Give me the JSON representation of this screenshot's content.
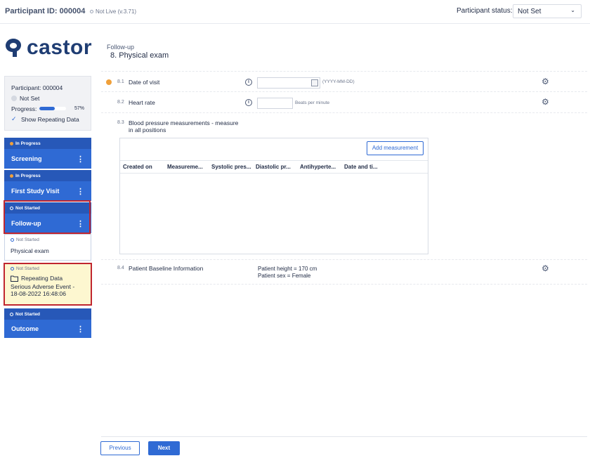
{
  "header": {
    "participant_id": "Participant ID: 000004",
    "env_label": "Not Live (v.3.71)",
    "participant_status_label": "Participant status:",
    "participant_status_value": "Not Set"
  },
  "brand": {
    "logo_text": "castor",
    "color": "#1f3d73"
  },
  "page": {
    "breadcrumb": "Follow-up",
    "title": "8. Physical exam"
  },
  "participant_card": {
    "participant": "Participant: 000004",
    "status": "Not Set",
    "progress_label": "Progress:",
    "progress_value": 0.57,
    "progress_pct": "57%",
    "show_repeating": "Show Repeating Data"
  },
  "sidebar": {
    "phases": [
      {
        "status": "In Progress",
        "name": "Screening"
      },
      {
        "status": "In Progress",
        "name": "First Study Visit"
      },
      {
        "status": "Not Started",
        "name": "Follow-up"
      },
      {
        "status": "Not Started",
        "name": "Outcome"
      }
    ],
    "step": {
      "status": "Not Started",
      "name": "Physical exam"
    },
    "repeating": {
      "status": "Not Started",
      "title": "Repeating Data",
      "line1": "Serious Adverse Event -",
      "line2": "18-08-2022 16:48:06"
    }
  },
  "form": {
    "q1": {
      "num": "8.1",
      "label": "Date of visit",
      "hint": "(YYYY-MM-DD)"
    },
    "q2": {
      "num": "8.2",
      "label": "Heart rate",
      "hint": "Beats per minute"
    },
    "q3": {
      "num": "8.3",
      "label_line1": "Blood pressure measurements - measure",
      "label_line2": "in all positions"
    },
    "q4": {
      "num": "8.4",
      "label": "Patient Baseline Information",
      "line1": "Patient height = 170 cm",
      "line2": "Patient sex = Female"
    },
    "grid": {
      "add_button": "Add measurement",
      "columns": [
        "Created on",
        "Measureme...",
        "Systolic pres...",
        "Diastolic pr...",
        "Antihyperte...",
        "Date and ti..."
      ]
    }
  },
  "footer": {
    "previous": "Previous",
    "next": "Next"
  },
  "colors": {
    "accent": "#2f6ad4",
    "in_progress": "#f0a03a",
    "highlight": "#fdf7d0",
    "outline": "#c0262f"
  }
}
